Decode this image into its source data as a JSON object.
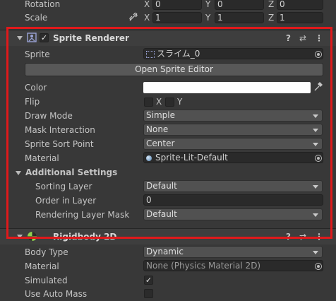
{
  "transform": {
    "rotation": {
      "label": "Rotation",
      "x": "0",
      "y": "0",
      "z": "0"
    },
    "scale": {
      "label": "Scale",
      "x": "1",
      "y": "1",
      "z": "1"
    },
    "axis_x": "X",
    "axis_y": "Y",
    "axis_z": "Z"
  },
  "sprite_renderer": {
    "title": "Sprite Renderer",
    "sprite_label": "Sprite",
    "sprite_value": "スライム_0",
    "open_editor": "Open Sprite Editor",
    "color_label": "Color",
    "color_value": "#ffffff",
    "flip_label": "Flip",
    "flip_x": "X",
    "flip_y": "Y",
    "draw_mode_label": "Draw Mode",
    "draw_mode": "Simple",
    "mask_label": "Mask Interaction",
    "mask": "None",
    "sort_point_label": "Sprite Sort Point",
    "sort_point": "Center",
    "material_label": "Material",
    "material": "Sprite-Lit-Default",
    "additional": "Additional Settings",
    "sorting_layer_label": "Sorting Layer",
    "sorting_layer": "Default",
    "order_label": "Order in Layer",
    "order": "0",
    "render_mask_label": "Rendering Layer Mask",
    "render_mask": "Default"
  },
  "rigidbody": {
    "title": "Rigidbody 2D",
    "body_type_label": "Body Type",
    "body_type": "Dynamic",
    "material_label": "Material",
    "material": "None (Physics Material 2D)",
    "simulated_label": "Simulated",
    "simulated": true,
    "auto_mass_label": "Use Auto Mass"
  },
  "header_icons": {
    "help": "?",
    "settings": "⇄",
    "menu": "⋮"
  },
  "highlight_color": "#e0191b"
}
